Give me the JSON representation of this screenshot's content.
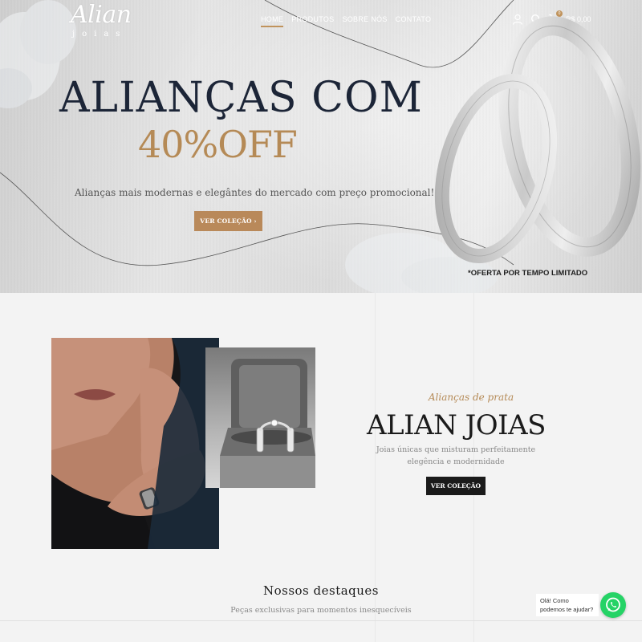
{
  "header": {
    "logo": {
      "name": "Alian",
      "sub": "joias"
    },
    "nav": [
      {
        "label": "HOME",
        "active": true
      },
      {
        "label": "PRODUTOS",
        "active": false
      },
      {
        "label": "SOBRE NÓS",
        "active": false
      },
      {
        "label": "CONTATO",
        "active": false
      }
    ],
    "icons": [
      "user-icon",
      "search-icon",
      "cart-icon"
    ],
    "cart_count": "0",
    "cart_total": "R$ 0,00"
  },
  "hero": {
    "title": "ALIANÇAS COM",
    "offer": "40%OFF",
    "subtitle": "Alianças mais modernas e elegântes do mercado com preço promocional!",
    "button": "VER COLEÇÃO ›",
    "note": "*OFERTA POR TEMPO LIMITADO"
  },
  "collection": {
    "eyebrow": "Alianças de prata",
    "title": "ALIAN JOIAS",
    "description": "Joias únicas que misturam perfeitamente elegência e modernidade",
    "button": "VER COLEÇÃO"
  },
  "featured": {
    "title": "Nossos destaques",
    "subtitle": "Peças exclusivas para momentos inesquecíveis"
  },
  "chat": {
    "message": "Olá! Como podemos te ajudar?",
    "icon": "whatsapp-icon"
  },
  "colors": {
    "accent_gold": "#b58a56",
    "dark_navy": "#1c2537",
    "whatsapp_green": "#25d366"
  }
}
